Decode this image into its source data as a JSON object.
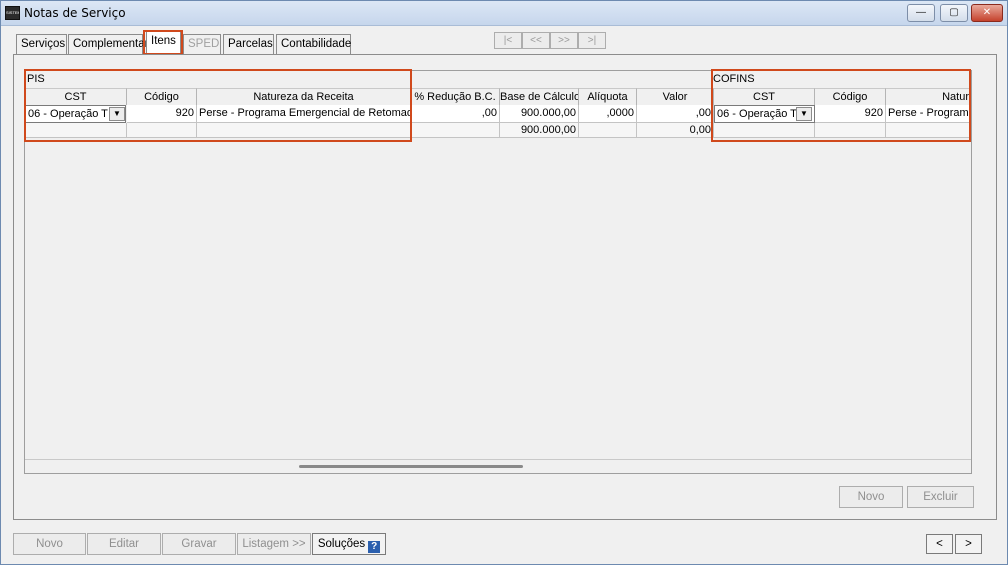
{
  "window": {
    "title": "Notas de Serviço",
    "app_icon_text": "SISTEMA",
    "controls": {
      "minimize": "—",
      "maximize": "▢",
      "close": "✕"
    }
  },
  "tabs": [
    {
      "label": "Serviços"
    },
    {
      "label": "Complementar"
    },
    {
      "label": "Itens"
    },
    {
      "label": "SPED"
    },
    {
      "label": "Parcelas"
    },
    {
      "label": "Contabilidade"
    }
  ],
  "nav": {
    "first": "|<",
    "prev": "<<",
    "next": ">>",
    "last": ">|"
  },
  "grid": {
    "pis_label": "PIS",
    "cofins_label": "COFINS",
    "headers": {
      "pis_cst": "CST",
      "pis_codigo": "Código",
      "pis_natureza": "Natureza da Receita",
      "reducao_bc": "% Redução B.C.",
      "base_calculo": "Base de Cálculo",
      "aliquota": "Alíquota",
      "valor": "Valor",
      "cofins_cst": "CST",
      "cofins_codigo": "Código",
      "cofins_natureza": "Natur"
    },
    "row": {
      "pis_cst": "06 - Operação T",
      "pis_codigo": "920",
      "pis_natureza": "Perse - Programa Emergencial de Retomado",
      "reducao_bc": ",00",
      "base_calculo": "900.000,00",
      "aliquota": ",0000",
      "valor": ",00",
      "cofins_cst": "06 - Operação T",
      "cofins_codigo": "920",
      "cofins_natureza": "Perse - Programa"
    },
    "totals": {
      "base_calculo": "900.000,00",
      "valor": "0,00"
    }
  },
  "panel_buttons": {
    "novo": "Novo",
    "excluir": "Excluir"
  },
  "footer_buttons": {
    "novo": "Novo",
    "editar": "Editar",
    "gravar": "Gravar",
    "listagem": "Listagem >>",
    "solucoes": "Soluções",
    "help": "?",
    "prev": "<",
    "next": ">"
  },
  "colors": {
    "highlight": "#d0491c",
    "help_icon": "#2b5fae"
  }
}
